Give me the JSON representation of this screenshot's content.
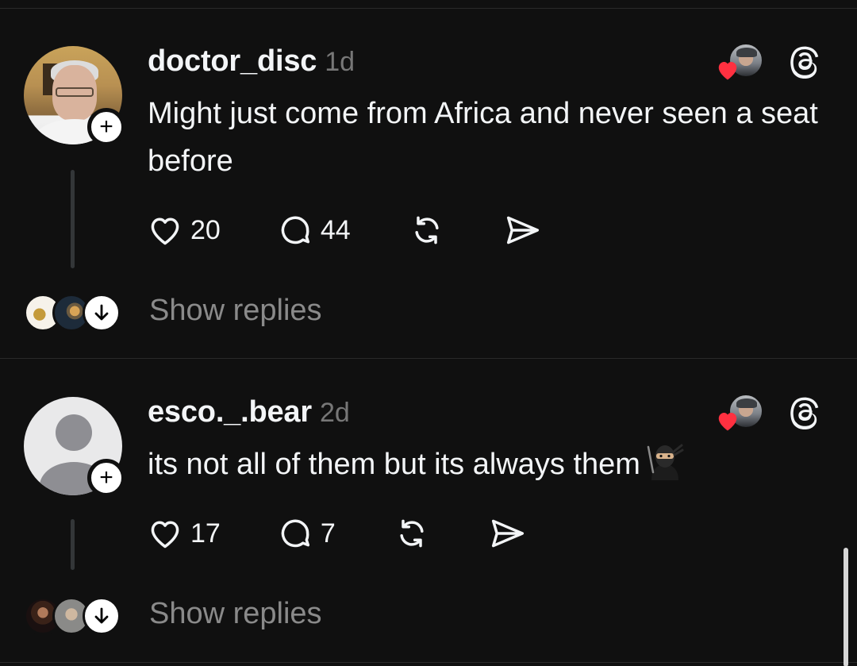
{
  "posts": [
    {
      "username": "doctor_disc",
      "time": "1d",
      "text": "Might just come from Africa and never seen a seat before",
      "likes": "20",
      "replies": "44",
      "show_replies": "Show replies"
    },
    {
      "username": "esco._.bear",
      "time": "2d",
      "text": "its not all of them but its always them",
      "likes": "17",
      "replies": "7",
      "show_replies": "Show replies"
    }
  ],
  "icons": {
    "like": "heart-icon",
    "reply": "comment-icon",
    "repost": "repost-icon",
    "share": "send-icon",
    "app": "threads-icon",
    "follow": "plus-icon",
    "expand": "arrow-down-icon"
  },
  "colors": {
    "background": "#101010",
    "text": "#f3f5f7",
    "muted": "#777777",
    "like_red": "#ff3040"
  }
}
